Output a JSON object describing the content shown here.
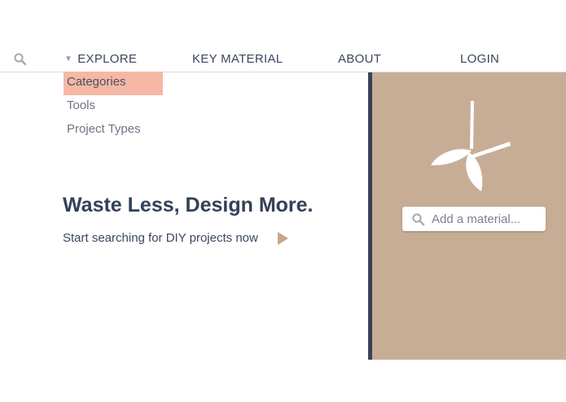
{
  "nav": {
    "explore_label": "EXPLORE",
    "key_material_label": "KEY MATERIAL",
    "about_label": "ABOUT",
    "login_label": "LOGIN"
  },
  "explore_menu": {
    "items": [
      {
        "label": "Categories",
        "active": true
      },
      {
        "label": "Tools",
        "active": false
      },
      {
        "label": "Project Types",
        "active": false
      }
    ]
  },
  "hero": {
    "title": "Waste Less, Design More.",
    "subtitle": "Start searching for DIY projects now"
  },
  "material_search": {
    "placeholder": "Add a material..."
  },
  "icons": {
    "nav_search": "search-icon",
    "explore_caret": "triangle-down-icon",
    "hero_arrow": "play-arrow-icon",
    "logo": "branch-leaves-logo",
    "material_search": "search-icon"
  },
  "colors": {
    "accent_highlight": "#f6b8a5",
    "panel_background": "#c8ad96",
    "divider": "#3c4159",
    "text_primary": "#34405a",
    "arrow": "#c4a78f"
  }
}
